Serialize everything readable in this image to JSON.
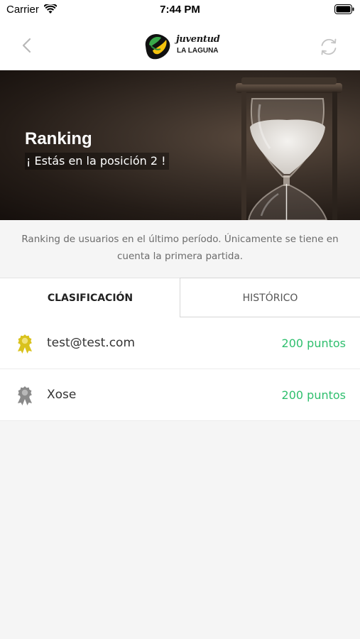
{
  "status_bar": {
    "carrier": "Carrier",
    "time": "7:44 PM"
  },
  "header": {
    "logo_title": "juventud",
    "logo_subtitle": "LA LAGUNA"
  },
  "hero": {
    "title": "Ranking",
    "subtitle": "¡ Estás en la posición 2 !"
  },
  "description": "Ranking de usuarios en el último período. Únicamente se tiene en cuenta la primera partida.",
  "tabs": [
    {
      "label": "CLASIFICACIÓN",
      "active": true
    },
    {
      "label": "HISTÓRICO",
      "active": false
    }
  ],
  "ranking": [
    {
      "name": "test@test.com",
      "points": "200 puntos",
      "medal": "gold-medal-icon",
      "medal_color": "#d9c21c"
    },
    {
      "name": "Xose",
      "points": "200 puntos",
      "medal": "silver-medal-icon",
      "medal_color": "#8a8a8a"
    }
  ],
  "colors": {
    "points": "#2fbf6e",
    "background": "#f5f5f5"
  }
}
